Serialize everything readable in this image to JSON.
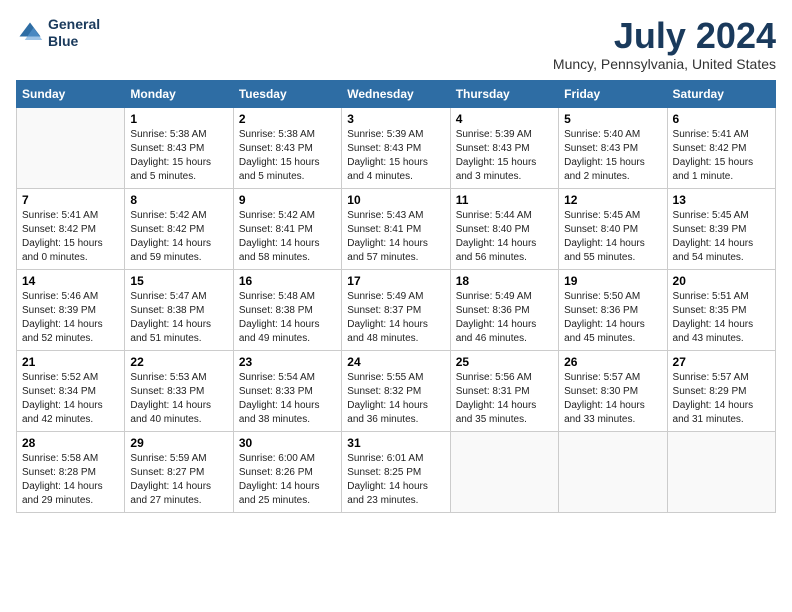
{
  "header": {
    "logo_line1": "General",
    "logo_line2": "Blue",
    "month_title": "July 2024",
    "location": "Muncy, Pennsylvania, United States"
  },
  "weekdays": [
    "Sunday",
    "Monday",
    "Tuesday",
    "Wednesday",
    "Thursday",
    "Friday",
    "Saturday"
  ],
  "weeks": [
    [
      {
        "day": "",
        "empty": true
      },
      {
        "day": "1",
        "sunrise": "5:38 AM",
        "sunset": "8:43 PM",
        "daylight": "15 hours and 5 minutes."
      },
      {
        "day": "2",
        "sunrise": "5:38 AM",
        "sunset": "8:43 PM",
        "daylight": "15 hours and 5 minutes."
      },
      {
        "day": "3",
        "sunrise": "5:39 AM",
        "sunset": "8:43 PM",
        "daylight": "15 hours and 4 minutes."
      },
      {
        "day": "4",
        "sunrise": "5:39 AM",
        "sunset": "8:43 PM",
        "daylight": "15 hours and 3 minutes."
      },
      {
        "day": "5",
        "sunrise": "5:40 AM",
        "sunset": "8:43 PM",
        "daylight": "15 hours and 2 minutes."
      },
      {
        "day": "6",
        "sunrise": "5:41 AM",
        "sunset": "8:42 PM",
        "daylight": "15 hours and 1 minute."
      }
    ],
    [
      {
        "day": "7",
        "sunrise": "5:41 AM",
        "sunset": "8:42 PM",
        "daylight": "15 hours and 0 minutes."
      },
      {
        "day": "8",
        "sunrise": "5:42 AM",
        "sunset": "8:42 PM",
        "daylight": "14 hours and 59 minutes."
      },
      {
        "day": "9",
        "sunrise": "5:42 AM",
        "sunset": "8:41 PM",
        "daylight": "14 hours and 58 minutes."
      },
      {
        "day": "10",
        "sunrise": "5:43 AM",
        "sunset": "8:41 PM",
        "daylight": "14 hours and 57 minutes."
      },
      {
        "day": "11",
        "sunrise": "5:44 AM",
        "sunset": "8:40 PM",
        "daylight": "14 hours and 56 minutes."
      },
      {
        "day": "12",
        "sunrise": "5:45 AM",
        "sunset": "8:40 PM",
        "daylight": "14 hours and 55 minutes."
      },
      {
        "day": "13",
        "sunrise": "5:45 AM",
        "sunset": "8:39 PM",
        "daylight": "14 hours and 54 minutes."
      }
    ],
    [
      {
        "day": "14",
        "sunrise": "5:46 AM",
        "sunset": "8:39 PM",
        "daylight": "14 hours and 52 minutes."
      },
      {
        "day": "15",
        "sunrise": "5:47 AM",
        "sunset": "8:38 PM",
        "daylight": "14 hours and 51 minutes."
      },
      {
        "day": "16",
        "sunrise": "5:48 AM",
        "sunset": "8:38 PM",
        "daylight": "14 hours and 49 minutes."
      },
      {
        "day": "17",
        "sunrise": "5:49 AM",
        "sunset": "8:37 PM",
        "daylight": "14 hours and 48 minutes."
      },
      {
        "day": "18",
        "sunrise": "5:49 AM",
        "sunset": "8:36 PM",
        "daylight": "14 hours and 46 minutes."
      },
      {
        "day": "19",
        "sunrise": "5:50 AM",
        "sunset": "8:36 PM",
        "daylight": "14 hours and 45 minutes."
      },
      {
        "day": "20",
        "sunrise": "5:51 AM",
        "sunset": "8:35 PM",
        "daylight": "14 hours and 43 minutes."
      }
    ],
    [
      {
        "day": "21",
        "sunrise": "5:52 AM",
        "sunset": "8:34 PM",
        "daylight": "14 hours and 42 minutes."
      },
      {
        "day": "22",
        "sunrise": "5:53 AM",
        "sunset": "8:33 PM",
        "daylight": "14 hours and 40 minutes."
      },
      {
        "day": "23",
        "sunrise": "5:54 AM",
        "sunset": "8:33 PM",
        "daylight": "14 hours and 38 minutes."
      },
      {
        "day": "24",
        "sunrise": "5:55 AM",
        "sunset": "8:32 PM",
        "daylight": "14 hours and 36 minutes."
      },
      {
        "day": "25",
        "sunrise": "5:56 AM",
        "sunset": "8:31 PM",
        "daylight": "14 hours and 35 minutes."
      },
      {
        "day": "26",
        "sunrise": "5:57 AM",
        "sunset": "8:30 PM",
        "daylight": "14 hours and 33 minutes."
      },
      {
        "day": "27",
        "sunrise": "5:57 AM",
        "sunset": "8:29 PM",
        "daylight": "14 hours and 31 minutes."
      }
    ],
    [
      {
        "day": "28",
        "sunrise": "5:58 AM",
        "sunset": "8:28 PM",
        "daylight": "14 hours and 29 minutes."
      },
      {
        "day": "29",
        "sunrise": "5:59 AM",
        "sunset": "8:27 PM",
        "daylight": "14 hours and 27 minutes."
      },
      {
        "day": "30",
        "sunrise": "6:00 AM",
        "sunset": "8:26 PM",
        "daylight": "14 hours and 25 minutes."
      },
      {
        "day": "31",
        "sunrise": "6:01 AM",
        "sunset": "8:25 PM",
        "daylight": "14 hours and 23 minutes."
      },
      {
        "day": "",
        "empty": true
      },
      {
        "day": "",
        "empty": true
      },
      {
        "day": "",
        "empty": true
      }
    ]
  ]
}
